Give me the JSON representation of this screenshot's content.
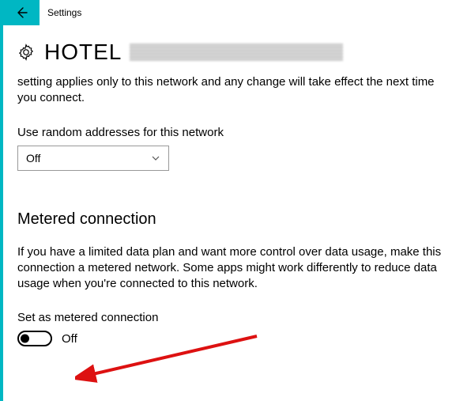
{
  "header": {
    "title": "Settings"
  },
  "network": {
    "name": "HOTEL",
    "description": "setting applies only to this network and any change will take effect the next time you connect."
  },
  "random_addresses": {
    "label": "Use random addresses for this network",
    "value": "Off"
  },
  "metered": {
    "title": "Metered connection",
    "description": "If you have a limited data plan and want more control over data usage, make this connection a metered network. Some apps might work differently to reduce data usage when you're connected to this network.",
    "toggle_label": "Set as metered connection",
    "toggle_state": "Off"
  }
}
